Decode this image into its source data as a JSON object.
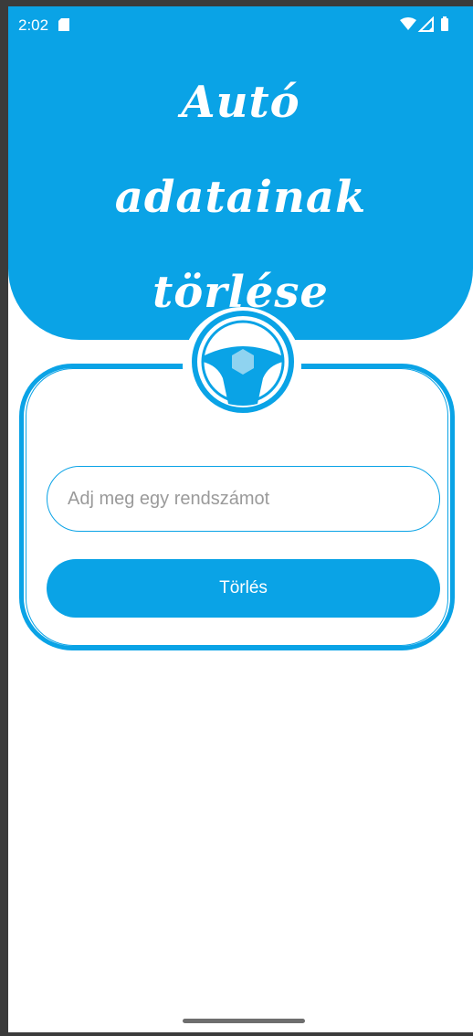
{
  "status_bar": {
    "time": "2:02",
    "icons": [
      "sd-card-icon",
      "wifi-icon",
      "signal-icon",
      "battery-icon"
    ]
  },
  "header": {
    "title_lines": [
      "Autó",
      "adatainak",
      "törlése"
    ]
  },
  "form": {
    "plate_input": {
      "value": "",
      "placeholder": "Adj meg egy rendszámot"
    },
    "delete_button_label": "Törlés"
  },
  "logo": {
    "icon": "steering-wheel-icon"
  },
  "colors": {
    "accent": "#0aa3e6",
    "background": "#ffffff",
    "hub": "#8fd3f0"
  }
}
